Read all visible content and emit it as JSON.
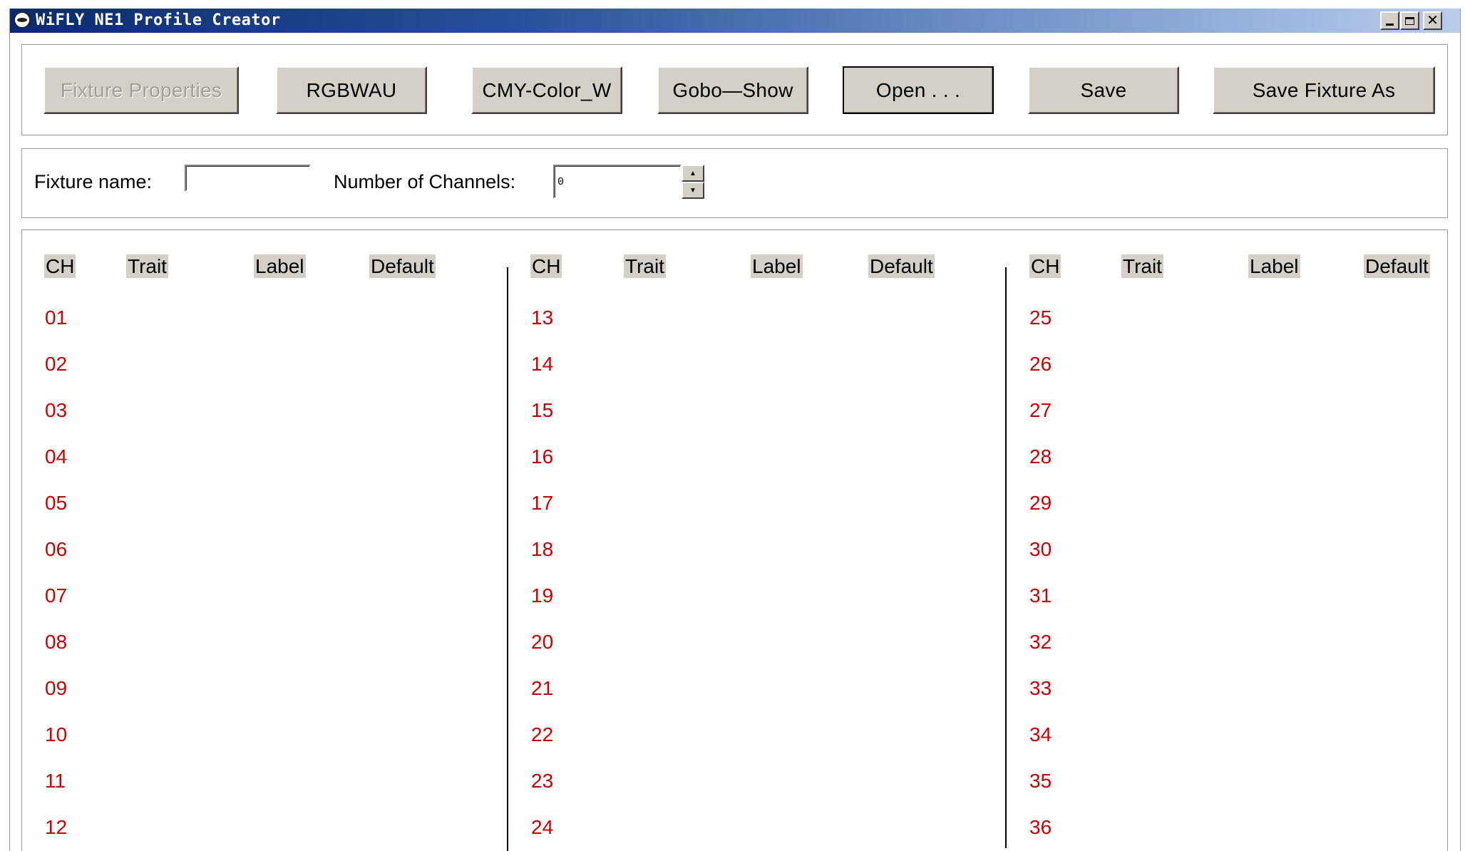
{
  "window": {
    "title": "WiFLY NE1 Profile Creator"
  },
  "toolbar": {
    "buttons": [
      {
        "label": "Fixture Properties",
        "enabled": false
      },
      {
        "label": "RGBWAU",
        "enabled": true
      },
      {
        "label": "CMY-Color_W",
        "enabled": true
      },
      {
        "label": "Gobo—Show",
        "enabled": true
      },
      {
        "label": "Open . . .",
        "enabled": true,
        "focused": true
      },
      {
        "label": "Save",
        "enabled": true
      },
      {
        "label": "Save Fixture As",
        "enabled": true
      }
    ]
  },
  "fixture": {
    "name_label": "Fixture name:",
    "name_value": "",
    "channels_label": "Number of Channels:",
    "channels_value": "0"
  },
  "grid": {
    "headers": [
      "CH",
      "Trait",
      "Label",
      "Default"
    ],
    "columns": [
      [
        "01",
        "02",
        "03",
        "04",
        "05",
        "06",
        "07",
        "08",
        "09",
        "10",
        "11",
        "12"
      ],
      [
        "13",
        "14",
        "15",
        "16",
        "17",
        "18",
        "19",
        "20",
        "21",
        "22",
        "23",
        "24"
      ],
      [
        "25",
        "26",
        "27",
        "28",
        "29",
        "30",
        "31",
        "32",
        "33",
        "34",
        "35",
        "36"
      ]
    ]
  },
  "colors": {
    "channel_number": "#cc0000",
    "button_face": "#d4d0c8",
    "title_gradient_start": "#0b2a6f",
    "title_gradient_end": "#b9cdec"
  }
}
